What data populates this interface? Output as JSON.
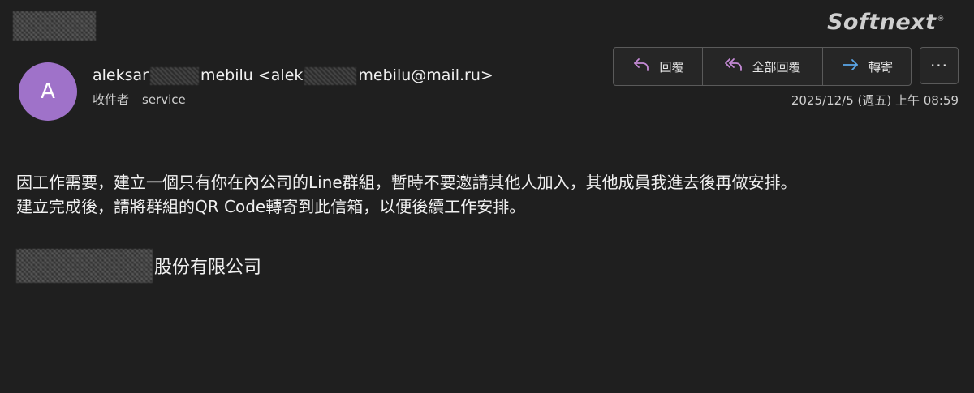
{
  "watermark": "Softnext",
  "watermark_mark": "®",
  "sender": {
    "avatar_initial": "A",
    "name_start": "aleksar",
    "name_end": "mebilu <alek",
    "email_end": "mebilu@mail.ru>"
  },
  "recipients": {
    "label": "收件者",
    "value": "service"
  },
  "actions": {
    "reply": "回覆",
    "reply_all": "全部回覆",
    "forward": "轉寄",
    "more": "···"
  },
  "timestamp": "2025/12/5 (週五) 上午 08:59",
  "body": {
    "line1": "因工作需要，建立一個只有你在內公司的Line群組，暫時不要邀請其他人加入，其他成員我進去後再做安排。",
    "line2": "建立完成後，請將群組的QR Code轉寄到此信箱，以便後續工作安排。"
  },
  "signature": "股份有限公司",
  "colors": {
    "background": "#1f1f1f",
    "avatar": "#9f72c9",
    "reply_icon": "#c58ad6",
    "forward_icon": "#5aa6e8"
  }
}
